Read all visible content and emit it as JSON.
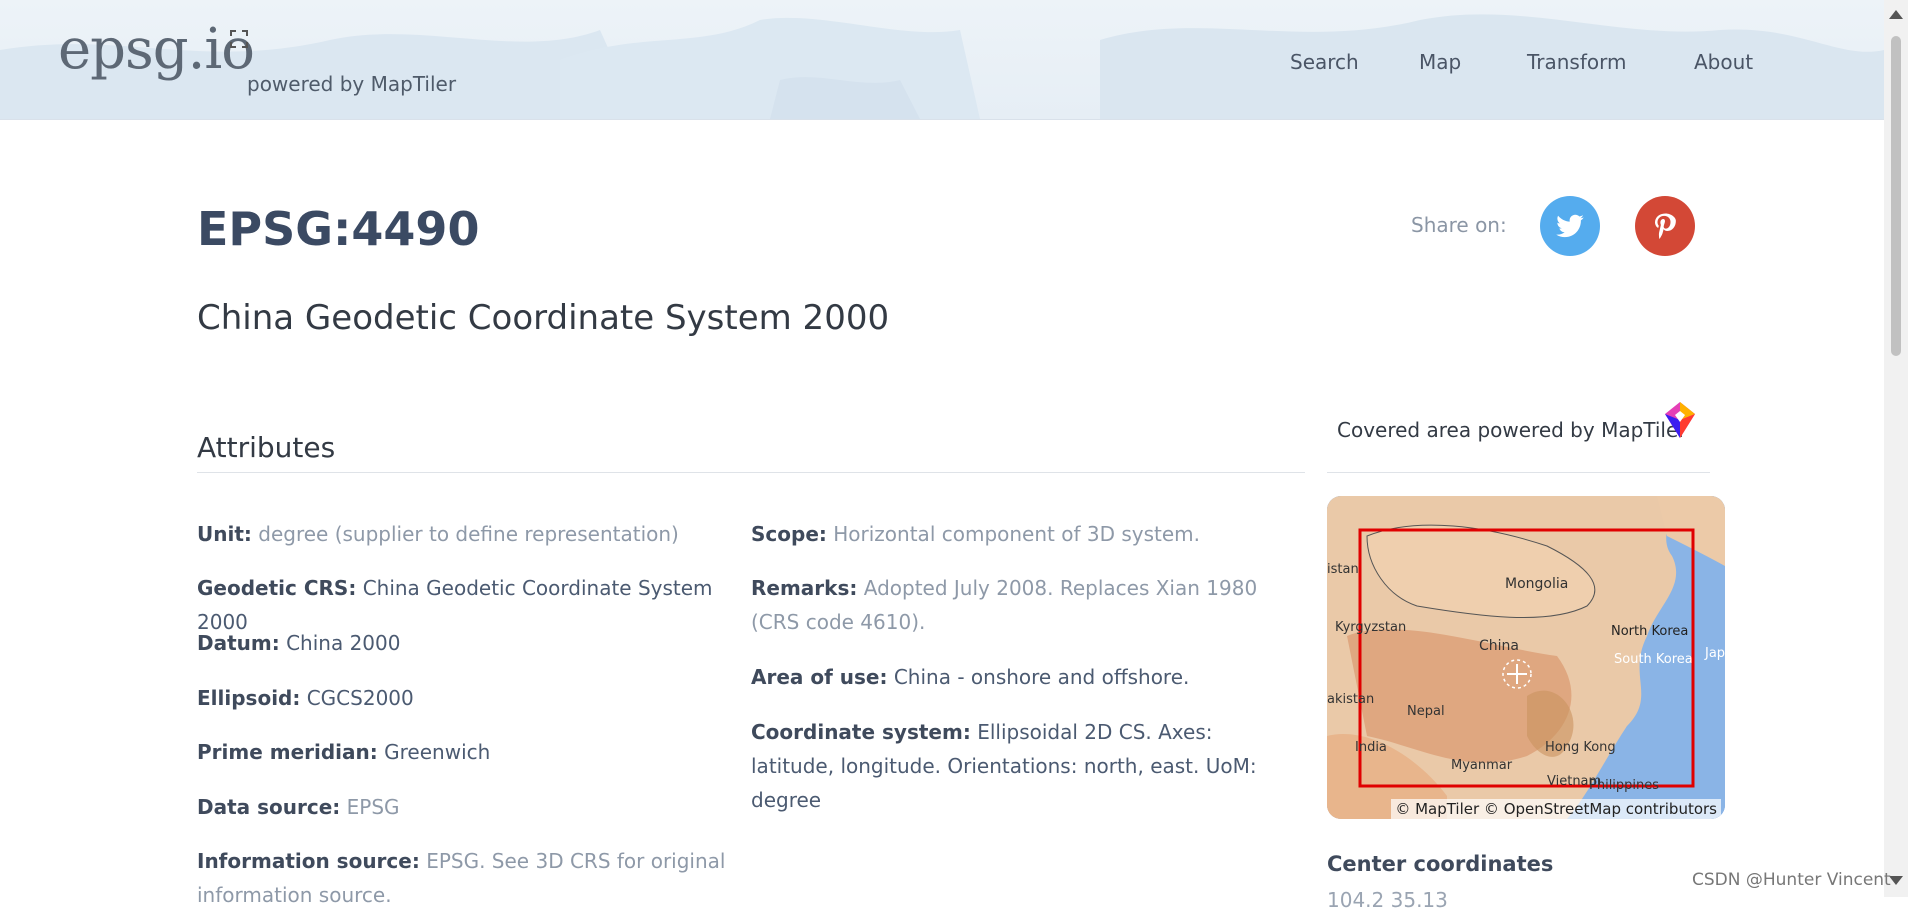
{
  "header": {
    "logo": "epsg.io",
    "powered_by": "powered by MapTiler",
    "nav": [
      "Search",
      "Map",
      "Transform",
      "About"
    ]
  },
  "crs": {
    "code": "EPSG:4490",
    "name": "China Geodetic Coordinate System 2000"
  },
  "share": {
    "label": "Share on:"
  },
  "attributes": {
    "heading": "Attributes",
    "left": [
      {
        "key": "Unit:",
        "value": "degree (supplier to define representation)"
      },
      {
        "key": "Geodetic CRS:",
        "value": "China Geodetic Coordinate System 2000"
      },
      {
        "key": "Datum:",
        "value": "China 2000"
      },
      {
        "key": "Ellipsoid:",
        "value": "CGCS2000"
      },
      {
        "key": "Prime meridian:",
        "value": "Greenwich"
      },
      {
        "key": "Data source:",
        "value": "EPSG"
      },
      {
        "key": "Information source:",
        "value": "EPSG. See 3D CRS for original information source."
      }
    ],
    "right": [
      {
        "key": "Scope:",
        "value": "Horizontal component of 3D system."
      },
      {
        "key": "Remarks:",
        "value": "Adopted July 2008. Replaces Xian 1980 (CRS code 4610)."
      },
      {
        "key": "Area of use:",
        "value": "China - onshore and offshore."
      },
      {
        "key": "Coordinate system:",
        "value": "Ellipsoidal 2D CS. Axes: latitude, longitude. Orientations: north, east. UoM: degree"
      }
    ]
  },
  "map": {
    "heading": "Covered area powered by MapTiler",
    "labels": [
      "Mongolia",
      "China",
      "Kyrgyzstan",
      "North Korea",
      "South Korea",
      "Japa",
      "Nepal",
      "India",
      "Myanmar",
      "Hong Kong",
      "Vietnam",
      "Philippines",
      "akistan",
      "istan"
    ],
    "attribution": "© MapTiler © OpenStreetMap contributors",
    "center_heading": "Center coordinates",
    "center_value": "104.2 35.13"
  },
  "watermark": "CSDN @Hunter Vincent"
}
